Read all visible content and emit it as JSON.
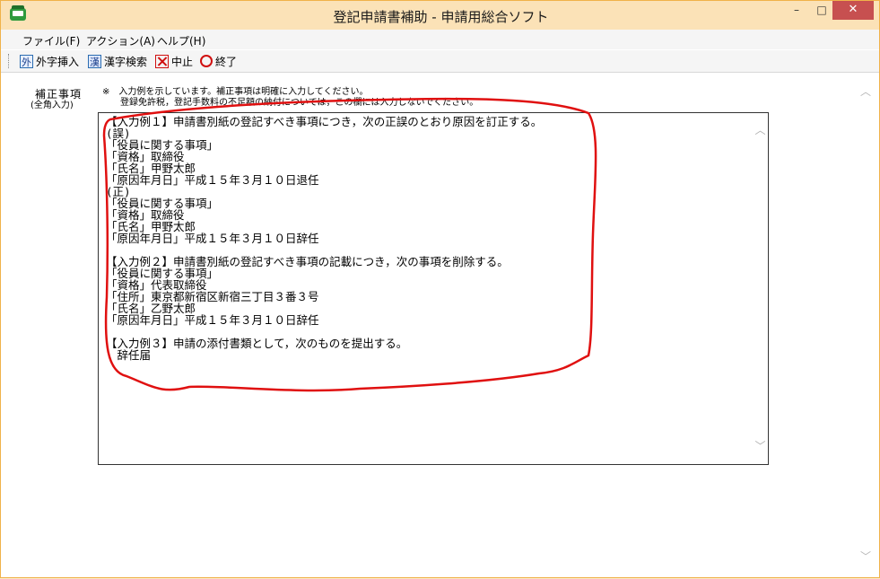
{
  "window": {
    "title": "登記申請書補助 - 申請用総合ソフト",
    "controls": {
      "minimize": "–",
      "maximize": "□",
      "close": "✕"
    }
  },
  "menu": {
    "items": [
      {
        "label": "ファイル(F)"
      },
      {
        "label": "アクション(A)"
      },
      {
        "label": "ヘルプ(H)"
      }
    ]
  },
  "toolbar": {
    "items": [
      {
        "label": "外字挿入",
        "icon": "gaiji-icon",
        "icon_text": "外"
      },
      {
        "label": "漢字検索",
        "icon": "kanji-search-icon",
        "icon_text": "漢"
      },
      {
        "label": "中止",
        "icon": "cancel-x-icon"
      },
      {
        "label": "終了",
        "icon": "exit-circle-icon"
      }
    ]
  },
  "form": {
    "field_label": "補正事項",
    "field_sublabel": "(全角入力)",
    "notes": [
      "※　入力例を示しています。補正事項は明確に入力してください。",
      "　　登録免許税，登記手数料の不足額の納付については，この欄には入力しないでください。"
    ],
    "text_lines": [
      "【入力例１】申請書別紙の登記すべき事項につき，次の正誤のとおり原因を訂正する。",
      "(誤)",
      "「役員に関する事項」",
      "「資格」取締役",
      "「氏名」甲野太郎",
      "「原因年月日」平成１５年３月１０日退任",
      "(正)",
      "「役員に関する事項」",
      "「資格」取締役",
      "「氏名」甲野太郎",
      "「原因年月日」平成１５年３月１０日辞任",
      "",
      "【入力例２】申請書別紙の登記すべき事項の記載につき，次の事項を削除する。",
      "「役員に関する事項」",
      "「資格」代表取締役",
      "「住所」東京都新宿区新宿三丁目３番３号",
      "「氏名」乙野太郎",
      "「原因年月日」平成１５年３月１０日辞任",
      "",
      "【入力例３】申請の添付書類として，次のものを提出する。",
      "　辞任届"
    ]
  },
  "colors": {
    "window_border": "#f0b24a",
    "titlebar_bg": "#fbe2b7",
    "close_button": "#c75050",
    "annotation": "#e01010"
  }
}
